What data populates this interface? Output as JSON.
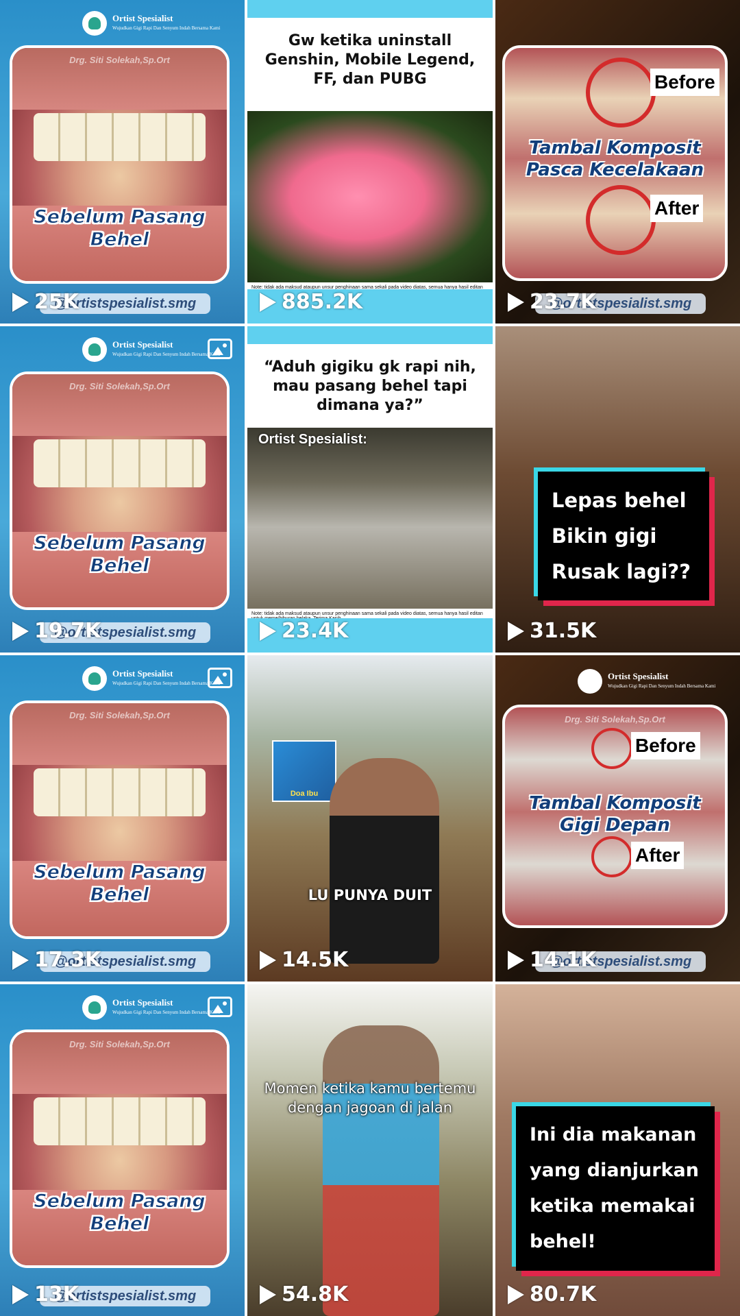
{
  "tiles": [
    {
      "views": "25K",
      "caption1": "Sebelum Pasang",
      "caption2": "Behel",
      "handle": "@ortistspesialist.smg",
      "watermark": "Drg. Siti Solekah,Sp.Ort"
    },
    {
      "views": "885.2K",
      "meme_text": "Gw ketika uninstall Genshin, Mobile Legend, FF, dan PUBG",
      "note": "Note: tidak ada maksud ataupun unsur penghinaan sama sekali pada video diatas, semua hanya hasil editan untuk meme/hiburan belaka. Terima Kasih."
    },
    {
      "views": "23.7K",
      "before": "Before",
      "after": "After",
      "title1": "Tambal Komposit",
      "title2": "Pasca Kecelakaan",
      "handle": "@ortistspesialist.smg"
    },
    {
      "views": "19.7K",
      "caption1": "Sebelum Pasang",
      "caption2": "Behel",
      "handle": "@ortistspesialist.smg",
      "watermark": "Drg. Siti Solekah,Sp.Ort"
    },
    {
      "views": "23.4K",
      "meme_text": "“Aduh gigiku gk rapi nih, mau pasang behel tapi dimana ya?”",
      "sub": "Ortist Spesialist:",
      "note": "Note: tidak ada maksud ataupun unsur penghinaan sama sekali pada video diatas, semua hanya hasil editan untuk meme/hiburan belaka. Terima Kasih."
    },
    {
      "views": "31.5K",
      "lines": [
        "Lepas behel",
        "Bikin gigi",
        "Rusak lagi??"
      ]
    },
    {
      "views": "17.3K",
      "caption1": "Sebelum Pasang",
      "caption2": "Behel",
      "handle": "@ortistspesialist.smg",
      "watermark": "Drg. Siti Solekah,Sp.Ort"
    },
    {
      "views": "14.5K",
      "caption": "LU PUNYA DUIT",
      "badge": "Doa Ibu"
    },
    {
      "views": "14.1K",
      "before": "Before",
      "after": "After",
      "title1": "Tambal Komposit",
      "title2": "Gigi Depan",
      "handle": "@ortistspesialist.smg",
      "watermark": "Drg. Siti Solekah,Sp.Ort"
    },
    {
      "views": "13K",
      "caption1": "Sebelum Pasang",
      "caption2": "Behel",
      "handle": "@ortistspesialist.smg",
      "watermark": "Drg. Siti Solekah,Sp.Ort"
    },
    {
      "views": "54.8K",
      "caption": "Momen ketika kamu bertemu dengan jagoan di jalan"
    },
    {
      "views": "80.7K",
      "lines": [
        "Ini dia makanan",
        "yang dianjurkan",
        "ketika memakai",
        "behel!"
      ]
    }
  ],
  "logo": {
    "name": "Ortist Spesialist",
    "tag": "Wujudkan Gigi Rapi Dan Senyum Indah Bersama Kami"
  }
}
